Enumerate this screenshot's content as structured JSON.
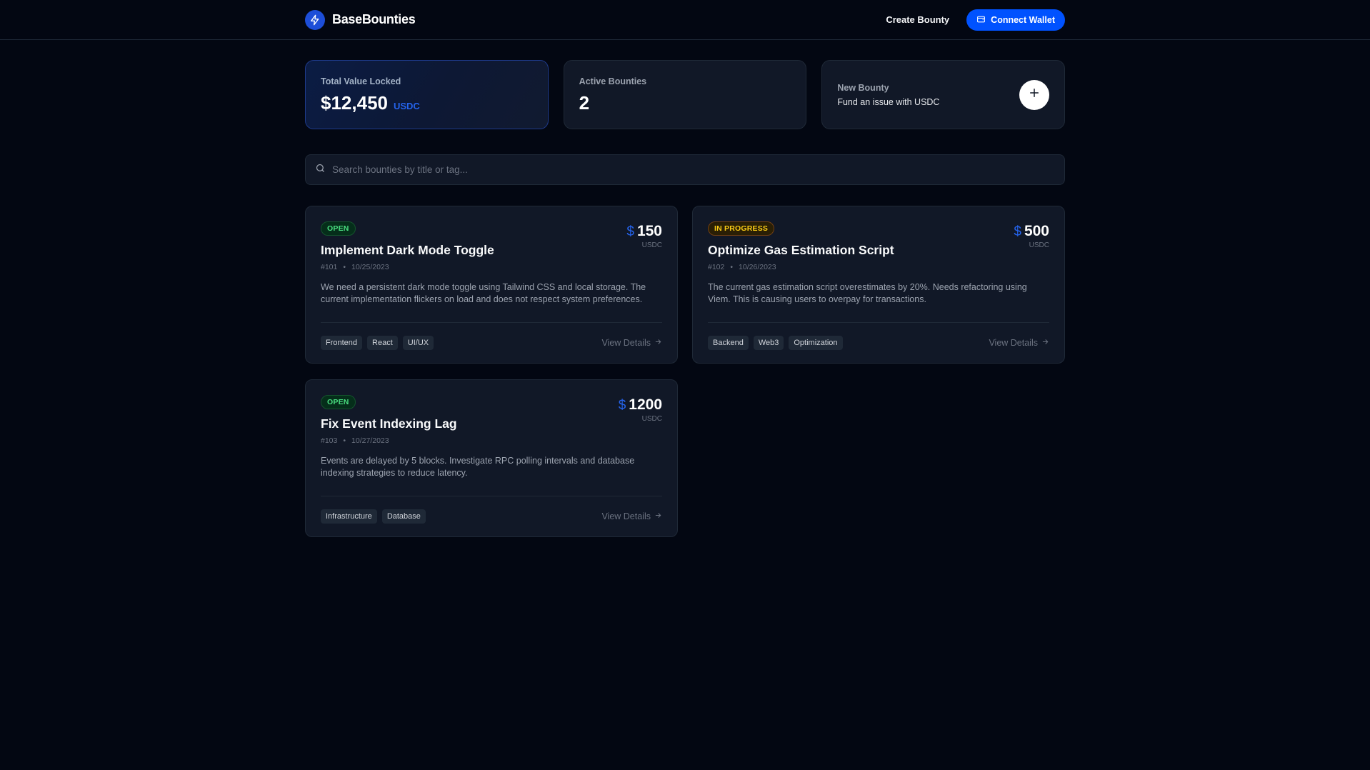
{
  "header": {
    "brand": "BaseBounties",
    "create_link": "Create Bounty",
    "wallet_button": "Connect Wallet"
  },
  "stats": {
    "tvl_label": "Total Value Locked",
    "tvl_value": "$12,450",
    "tvl_unit": "USDC",
    "active_label": "Active Bounties",
    "active_value": "2",
    "new_title": "New Bounty",
    "new_subtitle": "Fund an issue with USDC"
  },
  "search": {
    "placeholder": "Search bounties by title or tag..."
  },
  "bounties": [
    {
      "status": "OPEN",
      "title": "Implement Dark Mode Toggle",
      "id": "#101",
      "date": "10/25/2023",
      "amount": "150",
      "currency_symbol": "$",
      "unit": "USDC",
      "description": "We need a persistent dark mode toggle using Tailwind CSS and local storage. The current implementation flickers on load and does not respect system preferences.",
      "tags": [
        "Frontend",
        "React",
        "UI/UX"
      ],
      "details_label": "View Details"
    },
    {
      "status": "IN PROGRESS",
      "title": "Optimize Gas Estimation Script",
      "id": "#102",
      "date": "10/26/2023",
      "amount": "500",
      "currency_symbol": "$",
      "unit": "USDC",
      "description": "The current gas estimation script overestimates by 20%. Needs refactoring using Viem. This is causing users to overpay for transactions.",
      "tags": [
        "Backend",
        "Web3",
        "Optimization"
      ],
      "details_label": "View Details"
    },
    {
      "status": "OPEN",
      "title": "Fix Event Indexing Lag",
      "id": "#103",
      "date": "10/27/2023",
      "amount": "1200",
      "currency_symbol": "$",
      "unit": "USDC",
      "description": "Events are delayed by 5 blocks. Investigate RPC polling intervals and database indexing strategies to reduce latency.",
      "tags": [
        "Infrastructure",
        "Database"
      ],
      "details_label": "View Details"
    }
  ],
  "colors": {
    "background": "#030712",
    "card": "#111827",
    "accent": "#0052ff",
    "open": "#4ade80",
    "in_progress": "#facc15"
  },
  "icons": {
    "brand": "lightning-icon",
    "wallet": "wallet-icon",
    "plus": "plus-icon",
    "search": "search-icon",
    "arrow": "arrow-right-icon"
  }
}
